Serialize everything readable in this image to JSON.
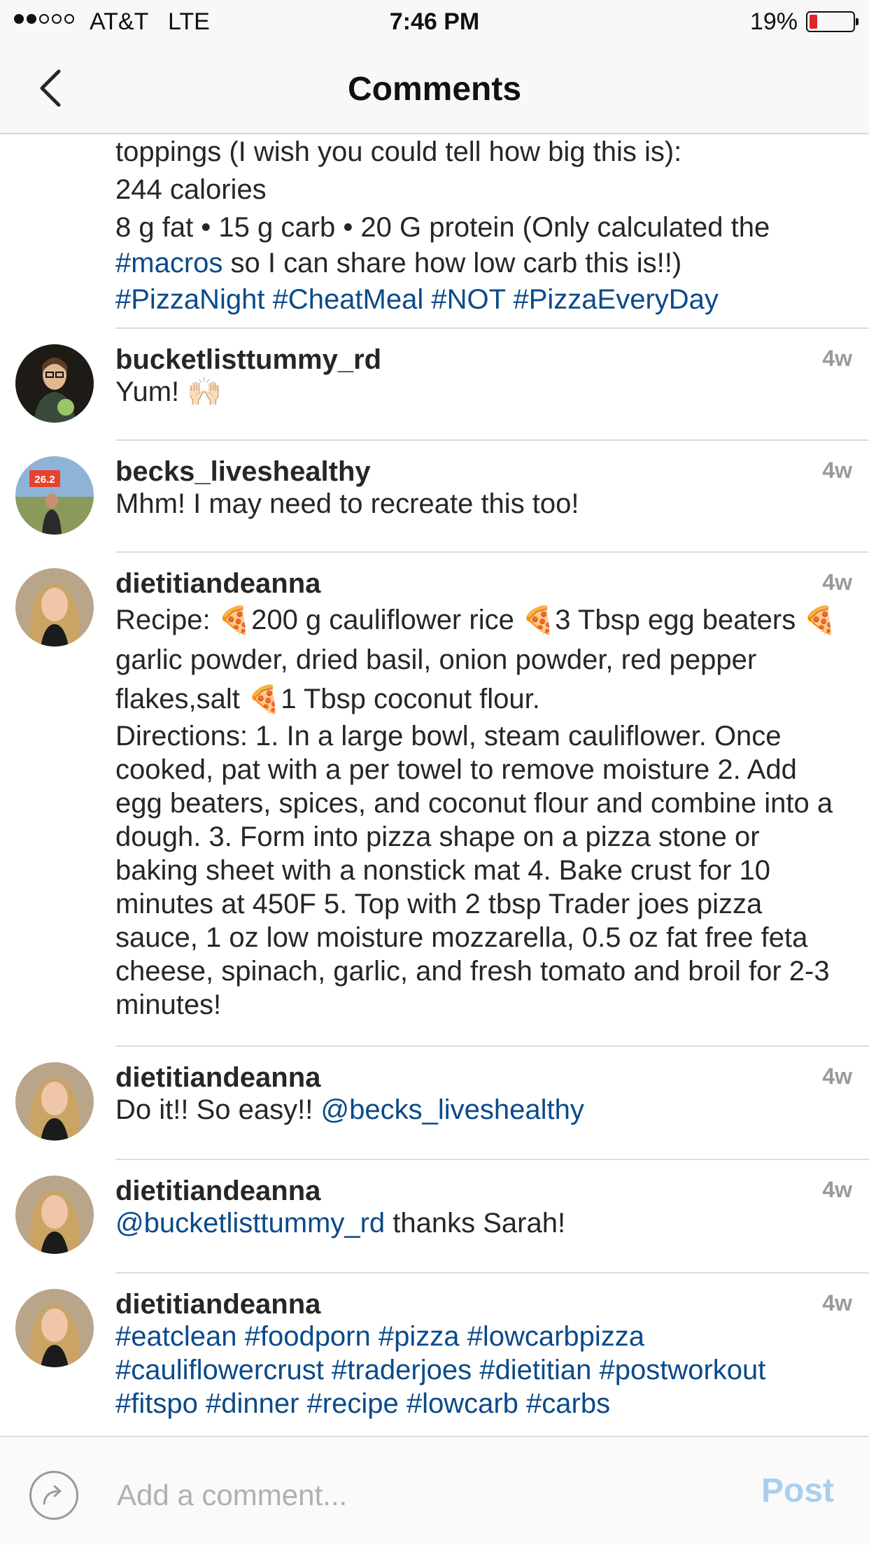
{
  "status_bar": {
    "carrier": "AT&T",
    "network": "LTE",
    "time": "7:46 PM",
    "battery_percent": "19%",
    "battery_level": 0.19,
    "signal_strength": 2,
    "signal_total": 5
  },
  "nav": {
    "title": "Comments",
    "back_icon": "chevron-left-icon"
  },
  "caption": {
    "line1": "toppings (I wish you could tell how big this is):",
    "line2": "244 calories",
    "line3": "8 g fat • 15 g carb • 20 G protein (Only calculated the",
    "tag_macros": "#macros",
    "line4_rest": " so I can share how low carb this is!!)",
    "tag1": "#PizzaNight",
    "tag2": "#CheatMeal",
    "tag3": "#NOT",
    "tag4": "#PizzaEveryDay"
  },
  "comments": [
    {
      "username": "bucketlisttummy_rd",
      "time": "4w",
      "text": "Yum! 🙌🏻"
    },
    {
      "username": "becks_liveshealthy",
      "time": "4w",
      "text": "Mhm! I may need to recreate this too!"
    },
    {
      "username": "dietitiandeanna",
      "time": "4w",
      "recipe_intro": "Recipe: ",
      "pizza_emoji": "🍕",
      "item1": "200 g cauliflower rice ",
      "item2": "3 Tbsp egg beaters ",
      "item3": "garlic powder, dried basil, onion powder, red pepper flakes,salt ",
      "item4": "1 Tbsp coconut flour.",
      "directions": "Directions: 1. In a large bowl, steam cauliflower. Once cooked, pat with a per towel to remove moisture 2. Add egg beaters, spices, and coconut flour and combine into a dough. 3. Form into pizza shape on a pizza stone or baking sheet with a nonstick mat 4. Bake crust for 10 minutes at 450F 5. Top with 2 tbsp Trader joes pizza sauce, 1 oz low moisture mozzarella, 0.5 oz fat free feta cheese, spinach, garlic, and fresh tomato and broil for 2-3 minutes!"
    },
    {
      "username": "dietitiandeanna",
      "time": "4w",
      "text_pre": "Do it!! So easy!! ",
      "mention": "@becks_liveshealthy"
    },
    {
      "username": "dietitiandeanna",
      "time": "4w",
      "mention": "@bucketlisttummy_rd",
      "text_post": " thanks Sarah!"
    },
    {
      "username": "dietitiandeanna",
      "time": "4w",
      "hashtags": "#eatclean #foodporn #pizza #lowcarbpizza #cauliflowercrust #traderjoes #dietitian #postworkout #fitspo #dinner #recipe #lowcarb #carbs"
    }
  ],
  "becks_badge": "26.2",
  "composer": {
    "placeholder": "Add a comment...",
    "post_label": "Post",
    "reply_icon": "reply-arrow-icon"
  }
}
